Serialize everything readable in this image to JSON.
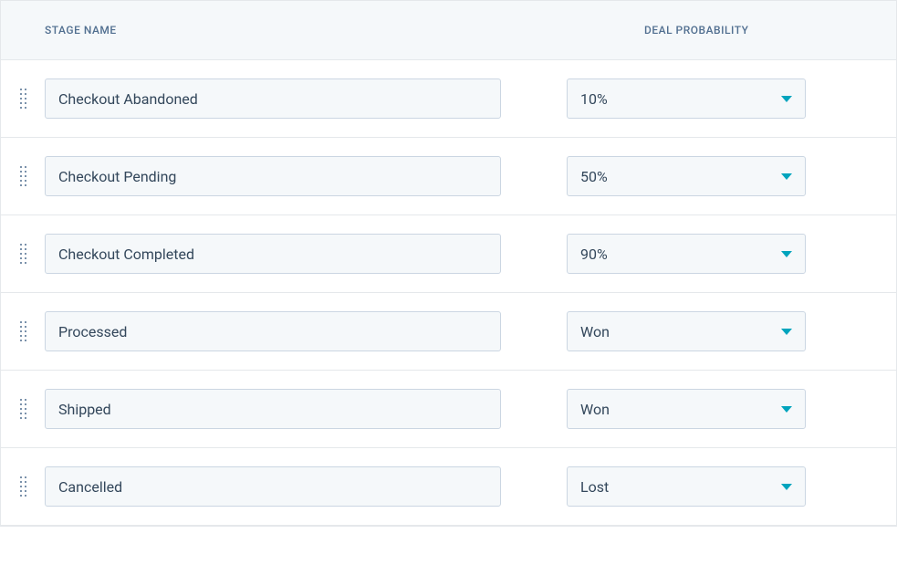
{
  "headers": {
    "stage": "STAGE NAME",
    "probability": "DEAL PROBABILITY"
  },
  "stages": [
    {
      "name": "Checkout Abandoned",
      "probability": "10%"
    },
    {
      "name": "Checkout Pending",
      "probability": "50%"
    },
    {
      "name": "Checkout Completed",
      "probability": "90%"
    },
    {
      "name": "Processed",
      "probability": "Won"
    },
    {
      "name": "Shipped",
      "probability": "Won"
    },
    {
      "name": "Cancelled",
      "probability": "Lost"
    }
  ]
}
